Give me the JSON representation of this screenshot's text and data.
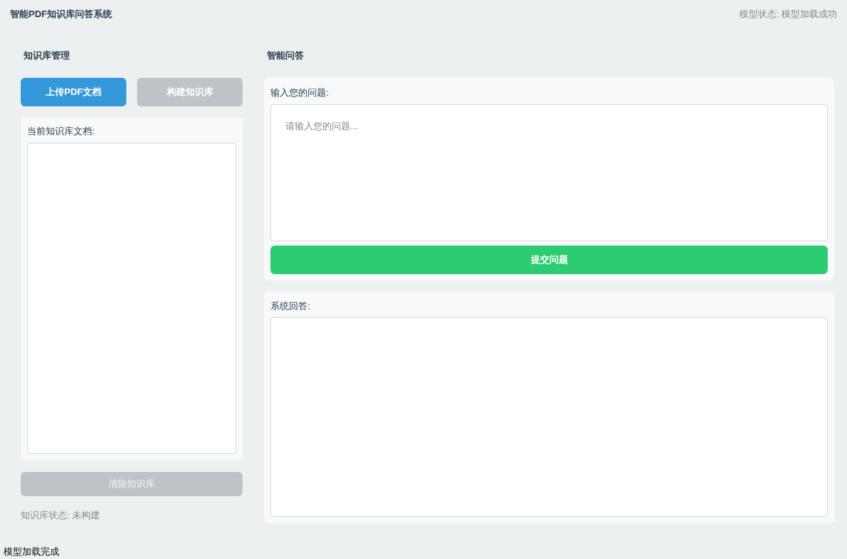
{
  "header": {
    "title": "智能PDF知识库问答系统",
    "model_status": "模型状态: 模型加载成功"
  },
  "knowledge": {
    "heading": "知识库管理",
    "buttons": [
      {
        "label": "上传PDF文档",
        "disabled": false
      },
      {
        "label": "构建知识库",
        "disabled": true
      }
    ],
    "docs_label": "当前知识库文档:",
    "clear_button": {
      "label": "清除知识库",
      "disabled": true
    },
    "status": "知识库状态: 未构建"
  },
  "qa": {
    "heading": "智能问答",
    "question_label": "输入您的问题:",
    "placeholder": "请输入您的问题...",
    "submit": "提交问题",
    "answer_label": "系统回答:"
  },
  "status_bar": "模型加载完成"
}
